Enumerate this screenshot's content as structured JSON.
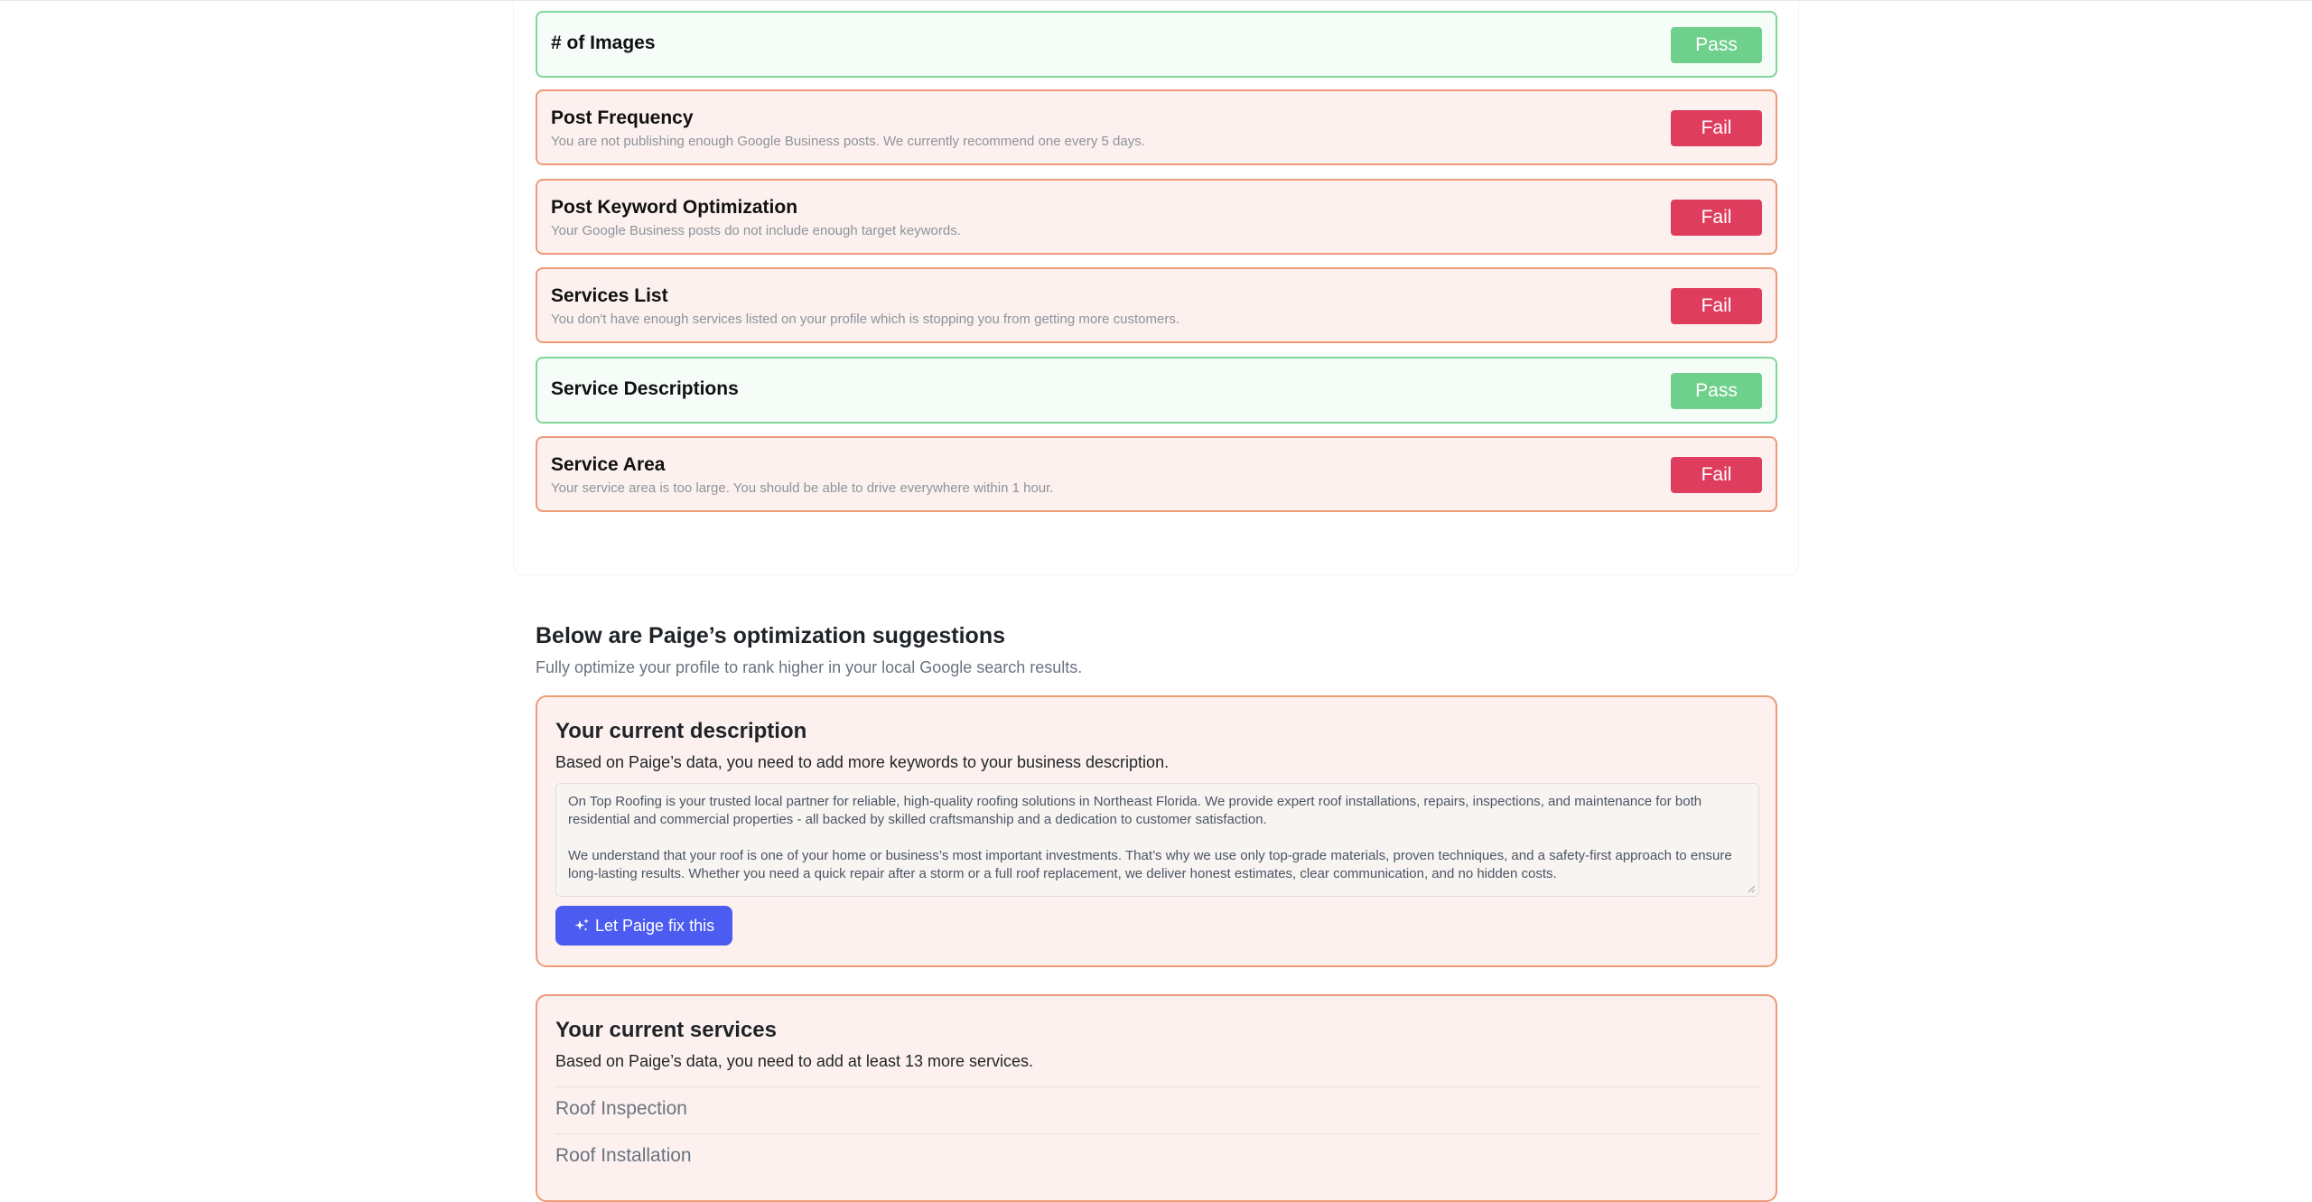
{
  "checks": [
    {
      "title": "# of Images",
      "status": "Pass",
      "description": ""
    },
    {
      "title": "Post Frequency",
      "status": "Fail",
      "description": "You are not publishing enough Google Business posts. We currently recommend one every 5 days."
    },
    {
      "title": "Post Keyword Optimization",
      "status": "Fail",
      "description": "Your Google Business posts do not include enough target keywords."
    },
    {
      "title": "Services List",
      "status": "Fail",
      "description": "You don't have enough services listed on your profile which is stopping you from getting more customers."
    },
    {
      "title": "Service Descriptions",
      "status": "Pass",
      "description": ""
    },
    {
      "title": "Service Area",
      "status": "Fail",
      "description": "Your service area is too large. You should be able to drive everywhere within 1 hour."
    }
  ],
  "suggestions": {
    "title": "Below are Paige’s optimization suggestions",
    "subtitle": "Fully optimize your profile to rank higher in your local Google search results."
  },
  "description_card": {
    "title": "Your current description",
    "text": "Based on Paige’s data, you need to add more keywords to your business description.",
    "paragraph1": "On Top Roofing is your trusted local partner for reliable, high-quality roofing solutions in Northeast Florida. We provide expert roof installations, repairs, inspections, and maintenance for both residential and commercial properties - all backed by skilled craftsmanship and a dedication to customer satisfaction.",
    "paragraph2": "We understand that your roof is one of your home or business’s most important investments. That’s why we use only top-grade materials, proven techniques, and a safety-first approach to ensure long-lasting results. Whether you need a quick repair after a storm or a full roof replacement, we deliver honest estimates, clear communication, and no hidden costs.",
    "button_label": "Let Paige fix this",
    "button_icon": "sparkle-icon"
  },
  "services_card": {
    "title": "Your current services",
    "text": "Based on Paige’s data, you need to add at least 13 more services.",
    "items": [
      "Roof Inspection",
      "Roof Installation"
    ]
  },
  "colors": {
    "pass": "#6fd08c",
    "fail": "#df3d5e",
    "accent": "#4c5bf0"
  }
}
